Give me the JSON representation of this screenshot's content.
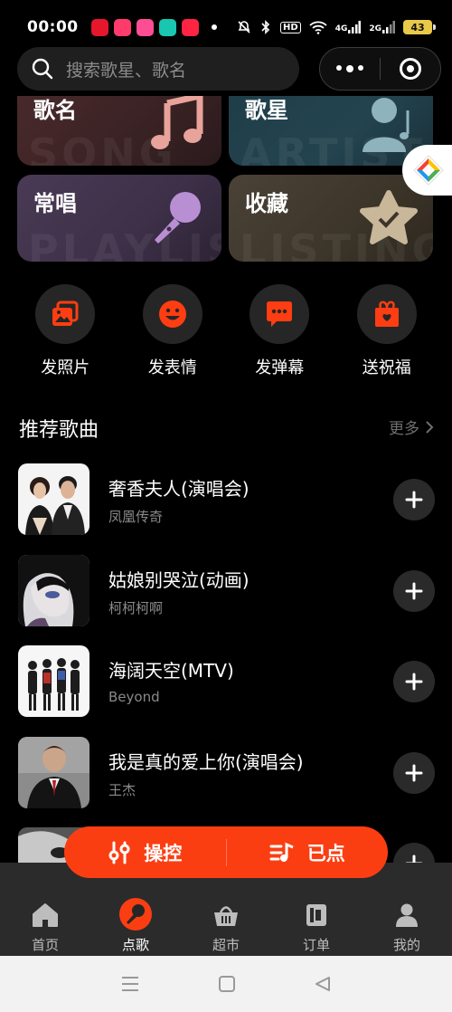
{
  "status": {
    "time": "00:00",
    "battery": "43",
    "hd_label": "HD",
    "net1": "4G",
    "net2": "2G"
  },
  "search": {
    "placeholder": "搜索歌星、歌名"
  },
  "cards": [
    {
      "label": "歌名",
      "ghost": "SONG"
    },
    {
      "label": "歌星",
      "ghost": "ARTIST"
    },
    {
      "label": "常唱",
      "ghost": "PLAYLIST"
    },
    {
      "label": "收藏",
      "ghost": "LISTING"
    }
  ],
  "actions": [
    {
      "label": "发照片",
      "icon": "photo-icon"
    },
    {
      "label": "发表情",
      "icon": "emoji-icon"
    },
    {
      "label": "发弹幕",
      "icon": "bullet-comment-icon"
    },
    {
      "label": "送祝福",
      "icon": "gift-icon"
    }
  ],
  "section": {
    "title": "推荐歌曲",
    "more": "更多"
  },
  "songs": [
    {
      "title": "奢香夫人(演唱会)",
      "artist": "凤凰传奇"
    },
    {
      "title": "姑娘别哭泣(动画)",
      "artist": "柯柯柯啊"
    },
    {
      "title": "海阔天空(MTV)",
      "artist": "Beyond"
    },
    {
      "title": "我是真的爱上你(演唱会)",
      "artist": "王杰"
    },
    {
      "title": "",
      "artist": ""
    }
  ],
  "pill": {
    "control": "操控",
    "queued": "已点"
  },
  "tabs": [
    {
      "label": "首页",
      "icon": "home-icon"
    },
    {
      "label": "点歌",
      "icon": "microphone-icon",
      "active": true
    },
    {
      "label": "超市",
      "icon": "basket-icon"
    },
    {
      "label": "订单",
      "icon": "order-icon"
    },
    {
      "label": "我的",
      "icon": "user-icon"
    }
  ],
  "colors": {
    "accent": "#fb3e12",
    "background": "#000000",
    "tabbar": "#2b2b2b"
  }
}
